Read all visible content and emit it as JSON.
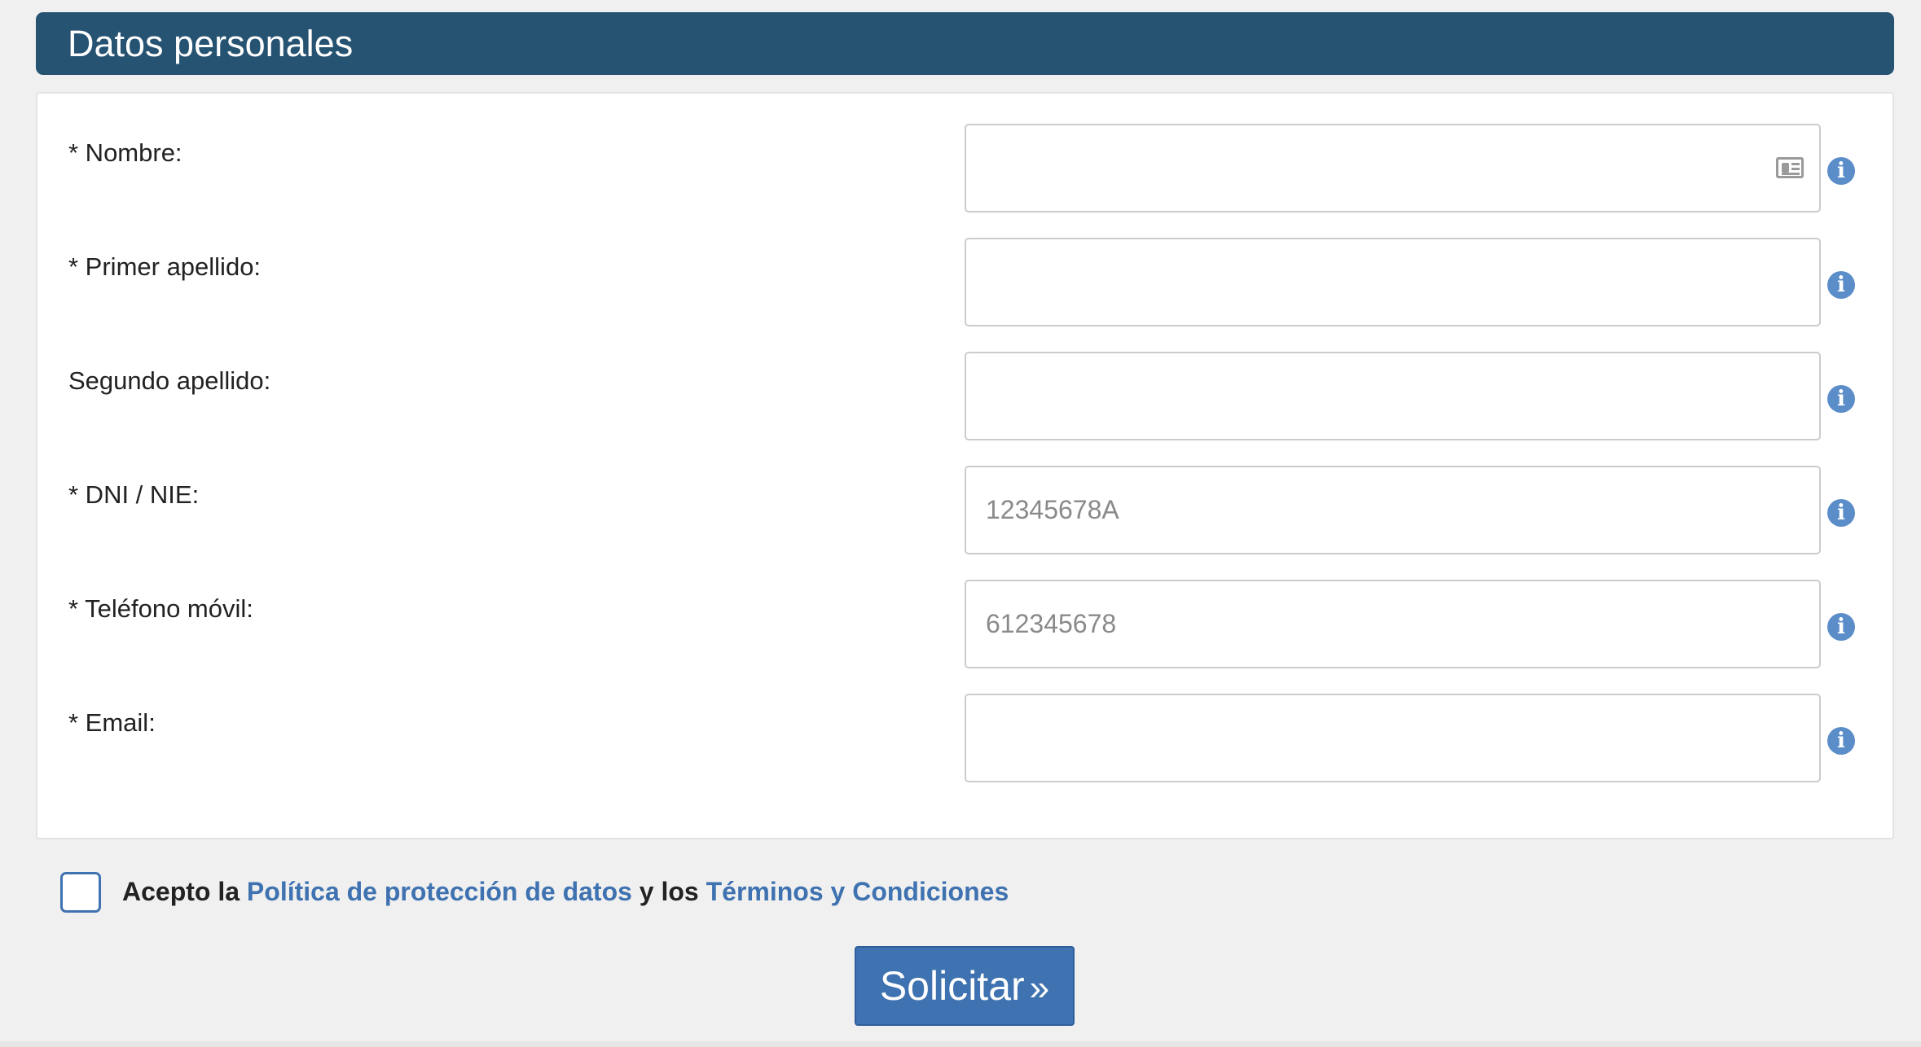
{
  "section": {
    "title": "Datos personales"
  },
  "fields": [
    {
      "label": "* Nombre:",
      "placeholder": "",
      "value": ""
    },
    {
      "label": "* Primer apellido:",
      "placeholder": "",
      "value": ""
    },
    {
      "label": "Segundo apellido:",
      "placeholder": "",
      "value": ""
    },
    {
      "label": "* DNI / NIE:",
      "placeholder": "12345678A",
      "value": ""
    },
    {
      "label": "* Teléfono móvil:",
      "placeholder": "612345678",
      "value": ""
    },
    {
      "label": "* Email:",
      "placeholder": "",
      "value": ""
    }
  ],
  "info_icon_glyph": "i",
  "consent": {
    "checked": false,
    "text_prefix": "Acepto la",
    "privacy_link": "Política de protección de datos",
    "text_middle": "y los",
    "terms_link": "Términos y Condiciones"
  },
  "submit": {
    "label": "Solicitar",
    "arrows": "»"
  },
  "icons": {
    "info": "info-circle-icon",
    "card": "id-card-icon",
    "submit_arrows": "double-chevron-right-icon"
  },
  "colors": {
    "header_bg": "#275372",
    "accent": "#3f72b0",
    "info_icon": "#5b8dc9",
    "page_bg": "#f0f0f0"
  }
}
